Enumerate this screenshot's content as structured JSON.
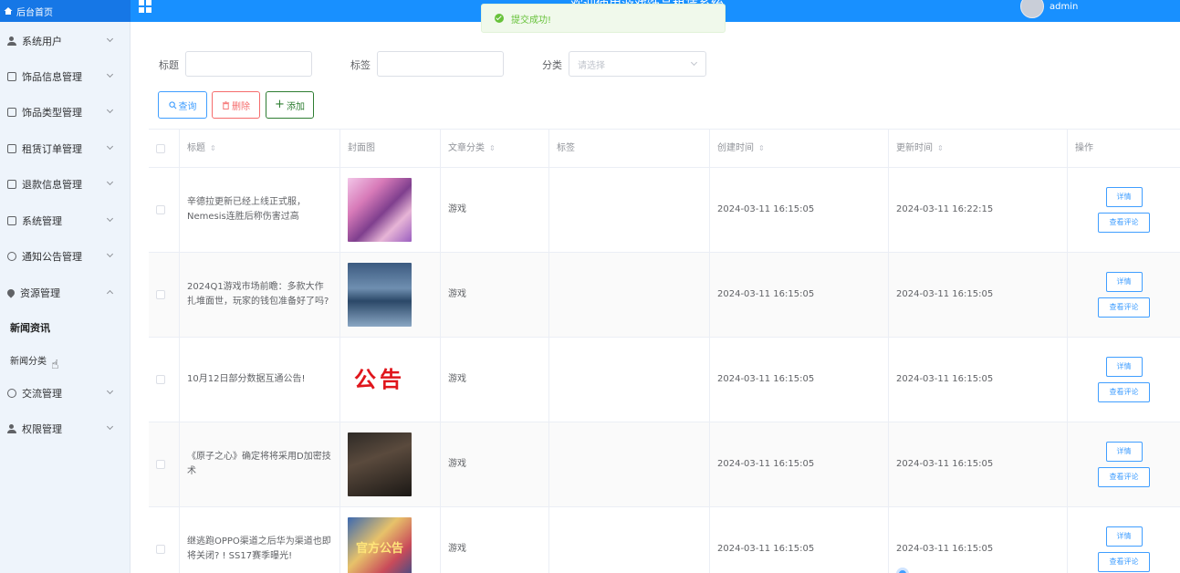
{
  "header": {
    "home_label": "后台首页",
    "system_title": "欢迎使用游戏饰品租赁系统",
    "username": "admin"
  },
  "toast": {
    "message": "提交成功!"
  },
  "sidebar": {
    "items": [
      {
        "label": "系统用户"
      },
      {
        "label": "饰品信息管理"
      },
      {
        "label": "饰品类型管理"
      },
      {
        "label": "租赁订单管理"
      },
      {
        "label": "退款信息管理"
      },
      {
        "label": "系统管理"
      },
      {
        "label": "通知公告管理"
      },
      {
        "label": "资源管理"
      },
      {
        "label": "交流管理"
      },
      {
        "label": "权限管理"
      }
    ],
    "sub_items": [
      {
        "label": "新闻资讯"
      },
      {
        "label": "新闻分类"
      }
    ]
  },
  "filters": {
    "title_label": "标题",
    "tag_label": "标签",
    "category_label": "分类",
    "category_placeholder": "请选择"
  },
  "actions": {
    "query": "查询",
    "delete": "删除",
    "add": "添加"
  },
  "table": {
    "headers": [
      "标题",
      "封面图",
      "文章分类",
      "标签",
      "创建时间",
      "更新时间",
      "操作"
    ],
    "detail_label": "详情",
    "comments_label": "查看评论",
    "rows": [
      {
        "title": "辛德拉更新已经上线正式服，Nemesis连胜后称伤害过高",
        "category": "游戏",
        "tag": "",
        "created": "2024-03-11 16:15:05",
        "updated": "2024-03-11 16:22:15"
      },
      {
        "title": "2024Q1游戏市场前瞻：多款大作扎堆面世，玩家的钱包准备好了吗?",
        "category": "游戏",
        "tag": "",
        "created": "2024-03-11 16:15:05",
        "updated": "2024-03-11 16:15:05"
      },
      {
        "title": "10月12日部分数据互通公告!",
        "category": "游戏",
        "tag": "",
        "created": "2024-03-11 16:15:05",
        "updated": "2024-03-11 16:15:05",
        "cover_text": "公告"
      },
      {
        "title": "《原子之心》确定将将采用D加密技术",
        "category": "游戏",
        "tag": "",
        "created": "2024-03-11 16:15:05",
        "updated": "2024-03-11 16:15:05"
      },
      {
        "title": "继逃跑OPPO渠道之后华为渠道也即将关闭? ! SS17赛季曝光!",
        "category": "游戏",
        "tag": "",
        "created": "2024-03-11 16:15:05",
        "updated": "2024-03-11 16:15:05",
        "cover_text": "官方公告"
      }
    ]
  },
  "colors": {
    "primary": "#1890ff",
    "success": "#67c23a",
    "danger": "#f56c6c",
    "add_green": "#2e7d32",
    "sidebar_bg": "#eef4fb"
  }
}
